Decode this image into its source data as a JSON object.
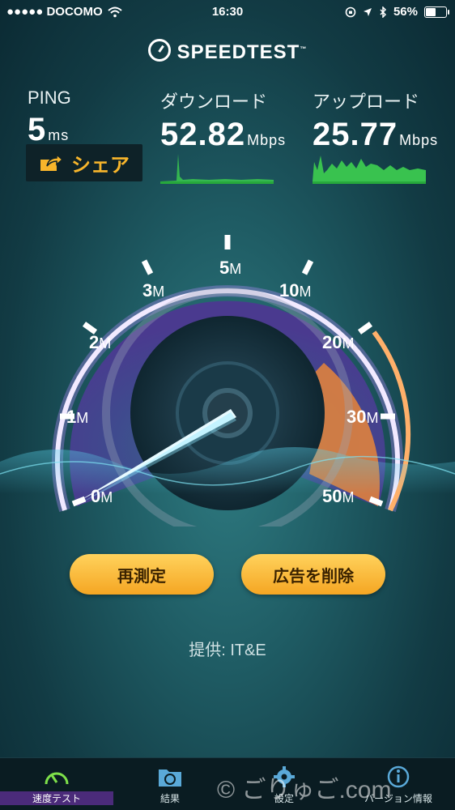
{
  "status_bar": {
    "carrier": "●●●●● DOCOMO",
    "time": "16:30",
    "battery_percent": "56%",
    "battery_level": 0.56
  },
  "app": {
    "title": "SPEEDTEST"
  },
  "ping": {
    "label": "PING",
    "value": "5",
    "unit": "ms"
  },
  "download": {
    "label": "ダウンロード",
    "value": "52.82",
    "unit": "Mbps"
  },
  "upload": {
    "label": "アップロード",
    "value": "25.77",
    "unit": "Mbps"
  },
  "share_button": {
    "label": "シェア"
  },
  "gauge": {
    "ticks": [
      {
        "num": "0",
        "unit": "M"
      },
      {
        "num": "1",
        "unit": "M"
      },
      {
        "num": "2",
        "unit": "M"
      },
      {
        "num": "3",
        "unit": "M"
      },
      {
        "num": "5",
        "unit": "M"
      },
      {
        "num": "10",
        "unit": "M"
      },
      {
        "num": "20",
        "unit": "M"
      },
      {
        "num": "30",
        "unit": "M"
      },
      {
        "num": "50",
        "unit": "M"
      }
    ],
    "accent_purple": "#b48cff",
    "accent_orange": "#ff9a3c"
  },
  "buttons": {
    "retest": "再測定",
    "remove_ads": "広告を削除"
  },
  "provider": "提供: IT&E",
  "tabs": [
    {
      "label": "速度テスト",
      "icon": "gauge-icon"
    },
    {
      "label": "結果",
      "icon": "folder-gauge-icon"
    },
    {
      "label": "設定",
      "icon": "gear-icon"
    },
    {
      "label": "バージョン情報",
      "icon": "info-icon"
    }
  ],
  "watermark": "© ごりゅご.com"
}
